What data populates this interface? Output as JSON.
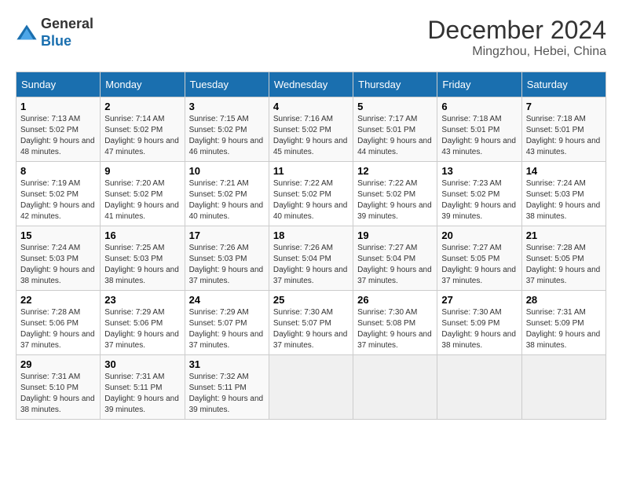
{
  "logo": {
    "general": "General",
    "blue": "Blue"
  },
  "header": {
    "month": "December 2024",
    "location": "Mingzhou, Hebei, China"
  },
  "weekdays": [
    "Sunday",
    "Monday",
    "Tuesday",
    "Wednesday",
    "Thursday",
    "Friday",
    "Saturday"
  ],
  "weeks": [
    [
      {
        "day": "1",
        "sunrise": "7:13 AM",
        "sunset": "5:02 PM",
        "daylight": "9 hours and 48 minutes."
      },
      {
        "day": "2",
        "sunrise": "7:14 AM",
        "sunset": "5:02 PM",
        "daylight": "9 hours and 47 minutes."
      },
      {
        "day": "3",
        "sunrise": "7:15 AM",
        "sunset": "5:02 PM",
        "daylight": "9 hours and 46 minutes."
      },
      {
        "day": "4",
        "sunrise": "7:16 AM",
        "sunset": "5:02 PM",
        "daylight": "9 hours and 45 minutes."
      },
      {
        "day": "5",
        "sunrise": "7:17 AM",
        "sunset": "5:01 PM",
        "daylight": "9 hours and 44 minutes."
      },
      {
        "day": "6",
        "sunrise": "7:18 AM",
        "sunset": "5:01 PM",
        "daylight": "9 hours and 43 minutes."
      },
      {
        "day": "7",
        "sunrise": "7:18 AM",
        "sunset": "5:01 PM",
        "daylight": "9 hours and 43 minutes."
      }
    ],
    [
      {
        "day": "8",
        "sunrise": "7:19 AM",
        "sunset": "5:02 PM",
        "daylight": "9 hours and 42 minutes."
      },
      {
        "day": "9",
        "sunrise": "7:20 AM",
        "sunset": "5:02 PM",
        "daylight": "9 hours and 41 minutes."
      },
      {
        "day": "10",
        "sunrise": "7:21 AM",
        "sunset": "5:02 PM",
        "daylight": "9 hours and 40 minutes."
      },
      {
        "day": "11",
        "sunrise": "7:22 AM",
        "sunset": "5:02 PM",
        "daylight": "9 hours and 40 minutes."
      },
      {
        "day": "12",
        "sunrise": "7:22 AM",
        "sunset": "5:02 PM",
        "daylight": "9 hours and 39 minutes."
      },
      {
        "day": "13",
        "sunrise": "7:23 AM",
        "sunset": "5:02 PM",
        "daylight": "9 hours and 39 minutes."
      },
      {
        "day": "14",
        "sunrise": "7:24 AM",
        "sunset": "5:03 PM",
        "daylight": "9 hours and 38 minutes."
      }
    ],
    [
      {
        "day": "15",
        "sunrise": "7:24 AM",
        "sunset": "5:03 PM",
        "daylight": "9 hours and 38 minutes."
      },
      {
        "day": "16",
        "sunrise": "7:25 AM",
        "sunset": "5:03 PM",
        "daylight": "9 hours and 38 minutes."
      },
      {
        "day": "17",
        "sunrise": "7:26 AM",
        "sunset": "5:03 PM",
        "daylight": "9 hours and 37 minutes."
      },
      {
        "day": "18",
        "sunrise": "7:26 AM",
        "sunset": "5:04 PM",
        "daylight": "9 hours and 37 minutes."
      },
      {
        "day": "19",
        "sunrise": "7:27 AM",
        "sunset": "5:04 PM",
        "daylight": "9 hours and 37 minutes."
      },
      {
        "day": "20",
        "sunrise": "7:27 AM",
        "sunset": "5:05 PM",
        "daylight": "9 hours and 37 minutes."
      },
      {
        "day": "21",
        "sunrise": "7:28 AM",
        "sunset": "5:05 PM",
        "daylight": "9 hours and 37 minutes."
      }
    ],
    [
      {
        "day": "22",
        "sunrise": "7:28 AM",
        "sunset": "5:06 PM",
        "daylight": "9 hours and 37 minutes."
      },
      {
        "day": "23",
        "sunrise": "7:29 AM",
        "sunset": "5:06 PM",
        "daylight": "9 hours and 37 minutes."
      },
      {
        "day": "24",
        "sunrise": "7:29 AM",
        "sunset": "5:07 PM",
        "daylight": "9 hours and 37 minutes."
      },
      {
        "day": "25",
        "sunrise": "7:30 AM",
        "sunset": "5:07 PM",
        "daylight": "9 hours and 37 minutes."
      },
      {
        "day": "26",
        "sunrise": "7:30 AM",
        "sunset": "5:08 PM",
        "daylight": "9 hours and 37 minutes."
      },
      {
        "day": "27",
        "sunrise": "7:30 AM",
        "sunset": "5:09 PM",
        "daylight": "9 hours and 38 minutes."
      },
      {
        "day": "28",
        "sunrise": "7:31 AM",
        "sunset": "5:09 PM",
        "daylight": "9 hours and 38 minutes."
      }
    ],
    [
      {
        "day": "29",
        "sunrise": "7:31 AM",
        "sunset": "5:10 PM",
        "daylight": "9 hours and 38 minutes."
      },
      {
        "day": "30",
        "sunrise": "7:31 AM",
        "sunset": "5:11 PM",
        "daylight": "9 hours and 39 minutes."
      },
      {
        "day": "31",
        "sunrise": "7:32 AM",
        "sunset": "5:11 PM",
        "daylight": "9 hours and 39 minutes."
      },
      null,
      null,
      null,
      null
    ]
  ]
}
